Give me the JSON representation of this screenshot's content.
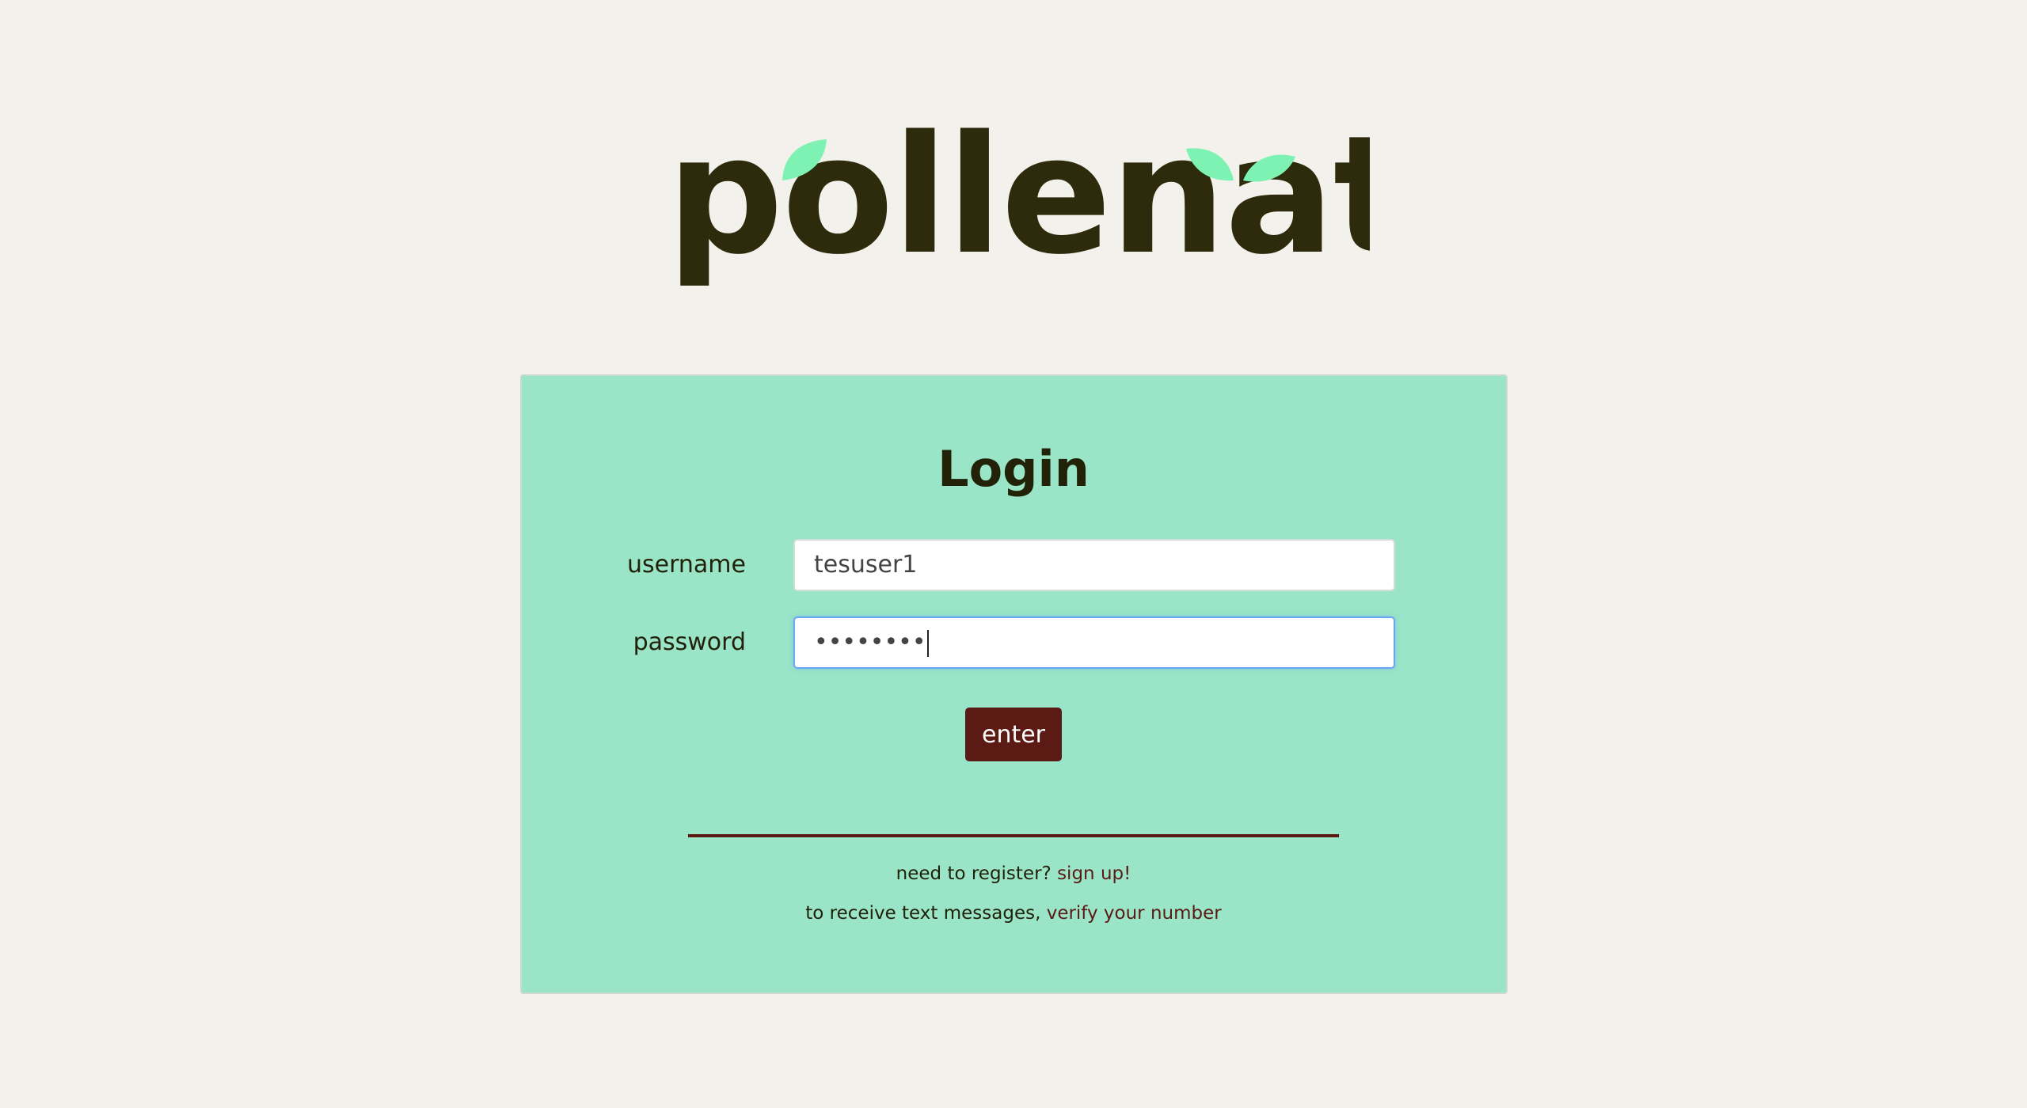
{
  "brand": {
    "logo_text": "pollenate",
    "text_color": "#2e2a0c",
    "leaf_color": "#7ef2b3"
  },
  "colors": {
    "background": "#f2f1ec",
    "panel": "#9ae5c8",
    "accent": "#5b1a13"
  },
  "login": {
    "title": "Login",
    "username_label": "username",
    "username_value": "tesuser1",
    "password_label": "password",
    "password_masked": "••••••••",
    "submit_label": "enter"
  },
  "footer": {
    "register_prefix": "need to register?",
    "register_link": "sign up!",
    "verify_prefix": "to receive text messages,",
    "verify_link": "verify your number"
  }
}
